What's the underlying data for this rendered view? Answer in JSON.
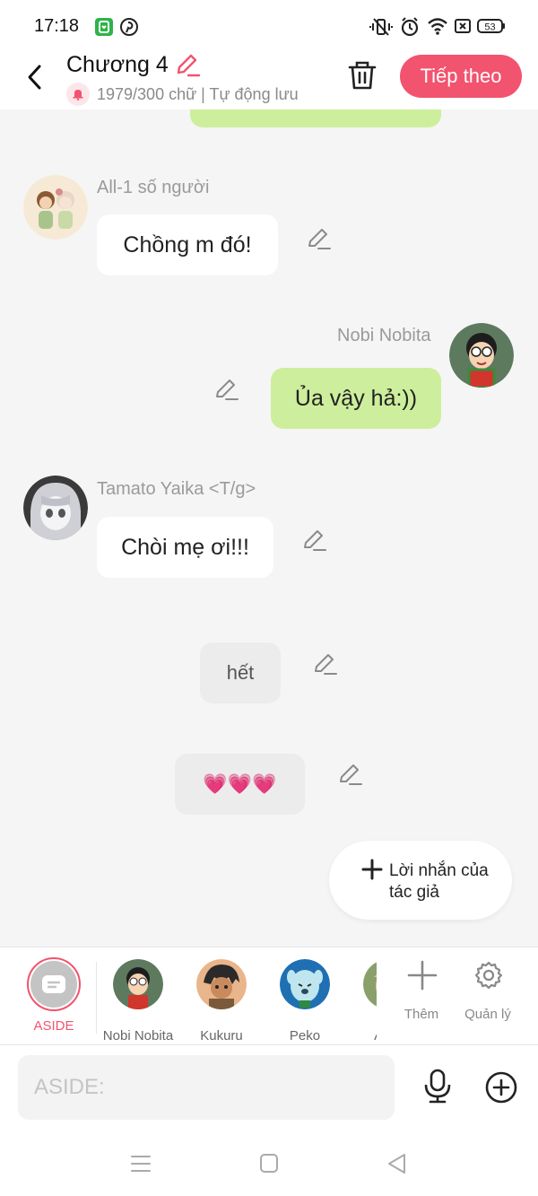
{
  "status_bar": {
    "time": "17:18",
    "battery": "53"
  },
  "header": {
    "title": "Chương 4",
    "subtitle": "1979/300 chữ | Tự động lưu",
    "next_label": "Tiếp theo"
  },
  "chat": {
    "messages": [
      {
        "speaker": "All-1 số người",
        "text": "Chồng m đó!",
        "side": "left"
      },
      {
        "speaker": "Nobi Nobita",
        "text": "Ủa vậy hả:))",
        "side": "right"
      },
      {
        "speaker": "Tamato Yaika <T/g>",
        "text": "Chòi mẹ ơi!!!",
        "side": "left"
      },
      {
        "speaker": "",
        "text": "hết",
        "side": "center"
      },
      {
        "speaker": "",
        "text": "💗💗💗",
        "side": "center"
      }
    ],
    "author_note_label": "Lời nhắn của tác giả"
  },
  "character_bar": {
    "aside_label": "ASIDE",
    "characters": [
      "Nobi Nobita",
      "Kukuru",
      "Peko",
      "Aron"
    ],
    "add_label": "Thêm",
    "manage_label": "Quản lý"
  },
  "input": {
    "placeholder": "ASIDE:"
  },
  "colors": {
    "accent": "#f2536e",
    "green_bubble": "#cdee9c",
    "background": "#f5f5f5"
  }
}
